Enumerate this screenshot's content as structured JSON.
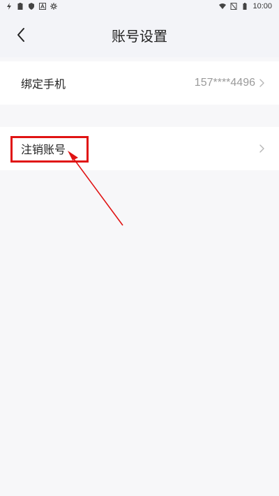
{
  "status_bar": {
    "time": "10:00",
    "left_icons": [
      "lightning-icon",
      "clipboard-icon",
      "shield-icon",
      "a-icon",
      "gear-icon"
    ],
    "right_icons": [
      "wifi-icon",
      "signal-off-icon",
      "battery-icon"
    ]
  },
  "header": {
    "title": "账号设置",
    "back_icon": "chevron-left-icon"
  },
  "settings": {
    "bind_phone": {
      "label": "绑定手机",
      "value": "157****4496"
    },
    "cancel_account": {
      "label": "注销账号"
    }
  },
  "annotation": {
    "color": "#e01313"
  }
}
